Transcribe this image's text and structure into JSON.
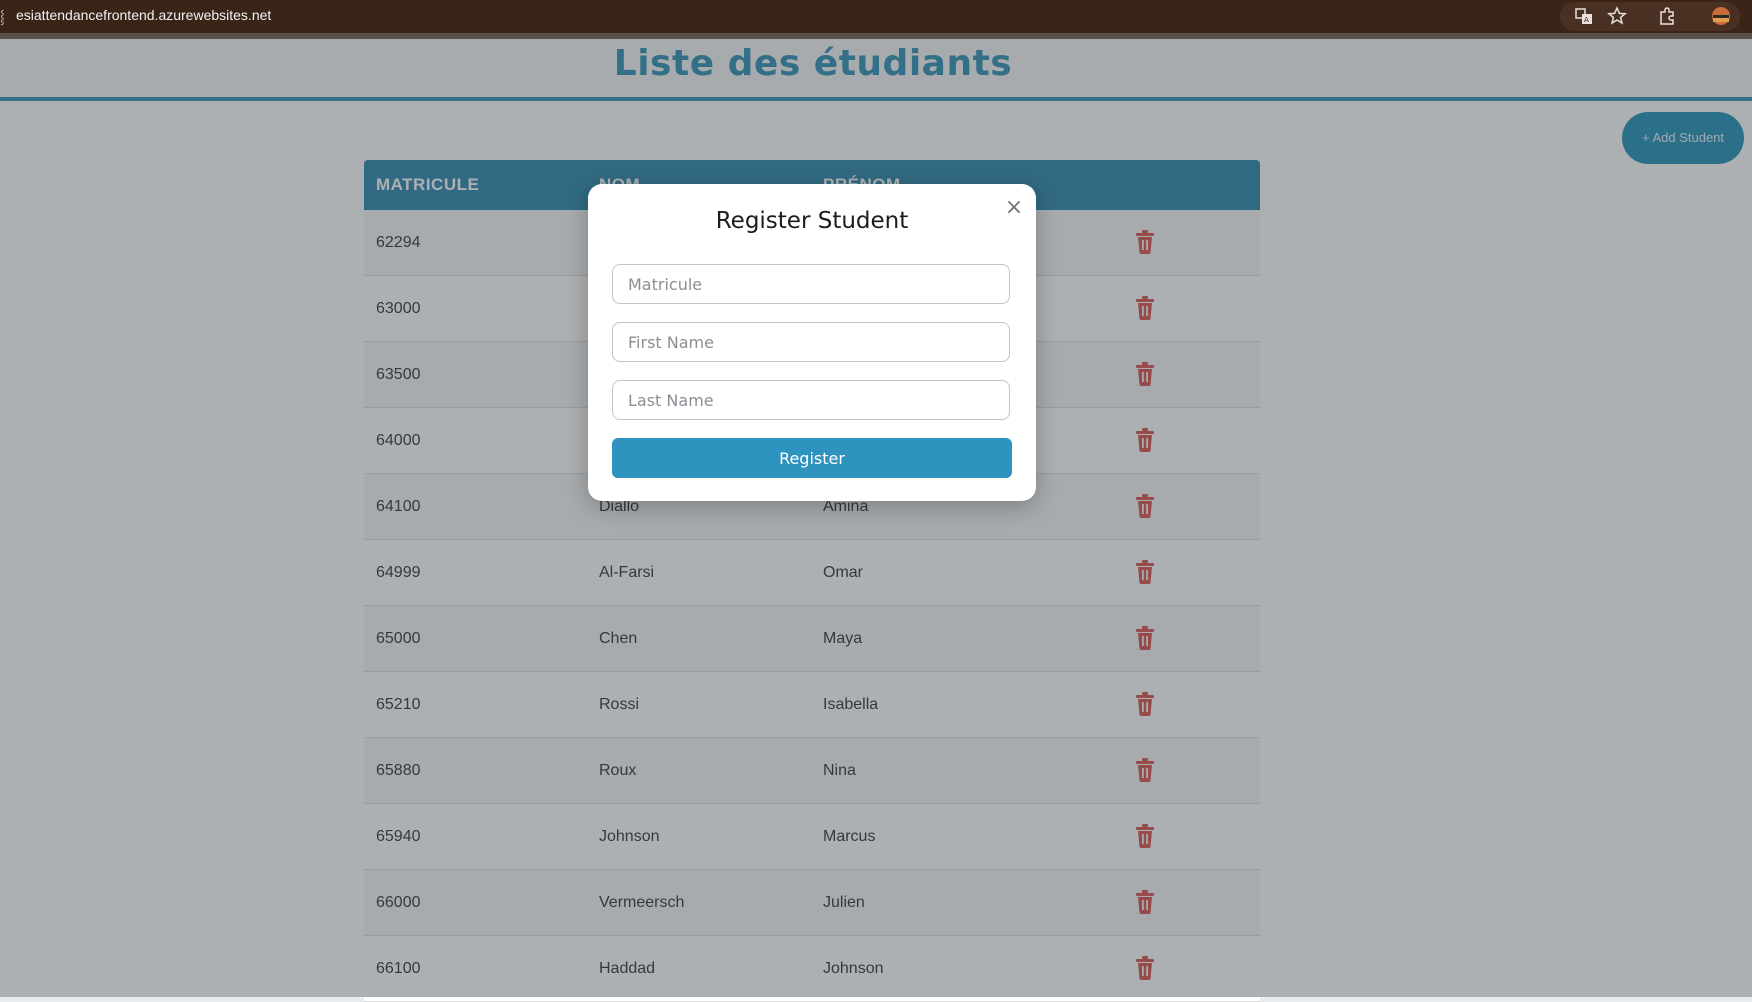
{
  "browser": {
    "url": "esiattendancefrontend.azurewebsites.net",
    "icons": [
      "translate-icon",
      "star-icon",
      "extensions-icon",
      "profile-avatar"
    ]
  },
  "page": {
    "title": "Liste des étudiants",
    "add_button_label": "+ Add Student"
  },
  "table": {
    "headers": [
      "MATRICULE",
      "NOM",
      "PRÉNOM"
    ],
    "rows": [
      {
        "matricule": "62294",
        "nom": "",
        "prenom": ""
      },
      {
        "matricule": "63000",
        "nom": "",
        "prenom": ""
      },
      {
        "matricule": "63500",
        "nom": "",
        "prenom": ""
      },
      {
        "matricule": "64000",
        "nom": "",
        "prenom": ""
      },
      {
        "matricule": "64100",
        "nom": "Diallo",
        "prenom": "Amina"
      },
      {
        "matricule": "64999",
        "nom": "Al-Farsi",
        "prenom": "Omar"
      },
      {
        "matricule": "65000",
        "nom": "Chen",
        "prenom": "Maya"
      },
      {
        "matricule": "65210",
        "nom": "Rossi",
        "prenom": "Isabella"
      },
      {
        "matricule": "65880",
        "nom": "Roux",
        "prenom": "Nina"
      },
      {
        "matricule": "65940",
        "nom": "Johnson",
        "prenom": "Marcus"
      },
      {
        "matricule": "66000",
        "nom": "Vermeersch",
        "prenom": "Julien"
      },
      {
        "matricule": "66100",
        "nom": "Haddad",
        "prenom": "Johnson"
      }
    ],
    "row_action_icon": "trash-icon"
  },
  "modal": {
    "title": "Register Student",
    "close_label": "×",
    "fields": {
      "matricule_placeholder": "Matricule",
      "first_name_placeholder": "First Name",
      "last_name_placeholder": "Last Name"
    },
    "submit_label": "Register"
  },
  "colors": {
    "accent": "#2f8fb7",
    "header_bg": "#2a87ac",
    "delete": "#d9534f"
  }
}
